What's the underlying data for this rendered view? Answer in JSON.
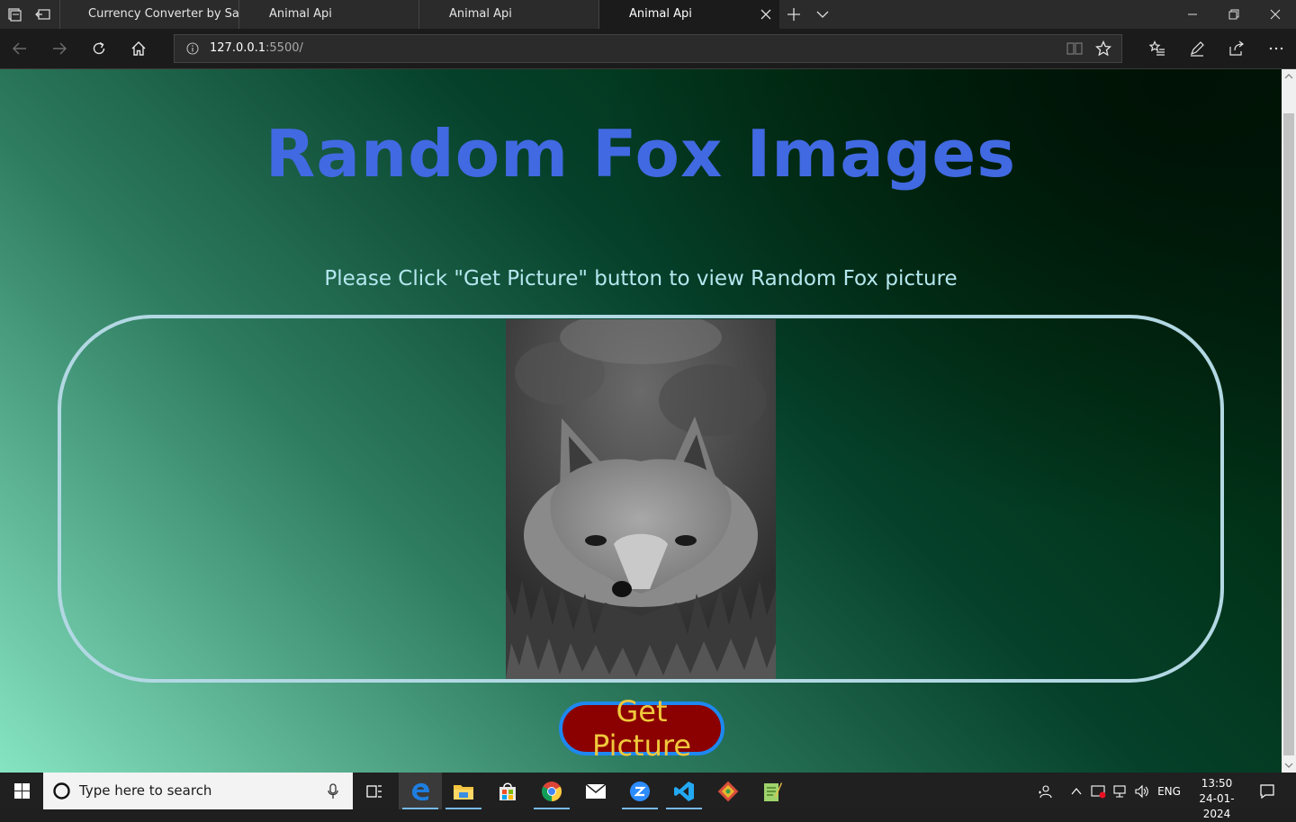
{
  "browser": {
    "tabs": [
      {
        "title": "Currency Converter by Sai C"
      },
      {
        "title": "Animal Api"
      },
      {
        "title": "Animal Api"
      },
      {
        "title": "Animal Api"
      }
    ],
    "address": {
      "host": "127.0.0.1",
      "rest": ":5500/"
    }
  },
  "page": {
    "title": "Random Fox Images",
    "instructions": "Please Click \"Get Picture\" button to view Random Fox picture",
    "button_label": "Get Picture",
    "colors": {
      "title": "#4169e1",
      "button_bg": "#8b0000",
      "button_text": "#f0c83c",
      "button_border": "#1e88f0",
      "frame_border": "#b2d8e3"
    }
  },
  "taskbar": {
    "search_placeholder": "Type here to search",
    "language": "ENG",
    "time": "13:50",
    "date": "24-01-2024",
    "apps": [
      "task-view-icon",
      "edge-icon",
      "file-explorer-icon",
      "store-icon",
      "chrome-icon",
      "mail-icon",
      "zoom-icon",
      "vscode-icon",
      "git-icon",
      "notepad-icon"
    ]
  }
}
